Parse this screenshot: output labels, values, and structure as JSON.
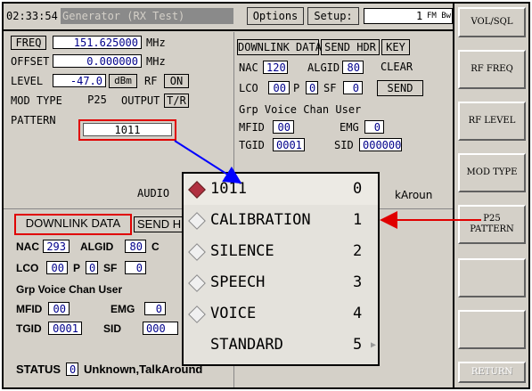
{
  "header": {
    "time": "02:33:54",
    "title": "Generator (RX Test)",
    "options_label": "Options",
    "setup_label": "Setup:",
    "setup_value": "1",
    "setup_unit": "FM Bw"
  },
  "generator": {
    "freq_label": "FREQ",
    "freq_value": "151.625000",
    "freq_unit": "MHz",
    "offset_label": "OFFSET",
    "offset_value": "0.000000",
    "offset_unit": "MHz",
    "level_label": "LEVEL",
    "level_value": "-47.0",
    "level_unit": "dBm",
    "rf_label": "RF",
    "rf_value": "ON",
    "modtype_label": "MOD TYPE",
    "modtype_value": "P25",
    "output_label": "OUTPUT",
    "output_value": "T/R",
    "pattern_label": "PATTERN",
    "pattern_value": "1011",
    "audio_label": "AUDIO"
  },
  "downlink_top": {
    "tab_label": "DOWNLINK DATA",
    "send_hdr_label": "SEND HDR",
    "key_label": "KEY",
    "nac_label": "NAC",
    "nac_value": "120",
    "algid_label": "ALGID",
    "algid_value": "80",
    "clear_label": "CLEAR",
    "lco_label": "LCO",
    "lco_value": "00",
    "p_label": "P",
    "p_value": "0",
    "sf_label": "SF",
    "sf_value": "0",
    "send_label": "SEND",
    "grp_label": "Grp Voice Chan User",
    "mfid_label": "MFID",
    "mfid_value": "00",
    "emg_label": "EMG",
    "emg_value": "0",
    "tgid_label": "TGID",
    "tgid_value": "0001",
    "sid_label": "SID",
    "sid_value": "000000",
    "status_partial": "kAroun"
  },
  "downlink_bottom": {
    "tab_label": "DOWNLINK DATA",
    "send_partial": "SEND HD",
    "nac_label": "NAC",
    "nac_value": "293",
    "algid_label": "ALGID",
    "algid_value": "80",
    "c_partial": "C",
    "lco_label": "LCO",
    "lco_value": "00",
    "p_label": "P",
    "p_value": "0",
    "sf_label": "SF",
    "sf_value": "0",
    "grp_label": "Grp Voice Chan User",
    "mfid_label": "MFID",
    "mfid_value": "00",
    "emg_label": "EMG",
    "emg_value": "0",
    "tgid_label": "TGID",
    "tgid_value": "0001",
    "sid_label": "SID",
    "sid_partial": "000"
  },
  "status": {
    "label": "STATUS",
    "value": "0",
    "text": "Unknown,TalkAround"
  },
  "dropdown": {
    "items": [
      {
        "label": "1011",
        "num": "0"
      },
      {
        "label": "CALIBRATION",
        "num": "1"
      },
      {
        "label": "SILENCE",
        "num": "2"
      },
      {
        "label": "SPEECH",
        "num": "3"
      },
      {
        "label": "VOICE",
        "num": "4"
      },
      {
        "label": "STANDARD",
        "num": "5"
      }
    ],
    "selected_index": 0
  },
  "sidebar": {
    "buttons": [
      "VOL/SQL",
      "RF FREQ",
      "RF LEVEL",
      "MOD TYPE",
      "P25 PATTERN",
      "",
      "",
      "RETURN"
    ]
  },
  "colors": {
    "annotation_red": "#e00000",
    "annotation_blue": "#0000ff",
    "value_blue": "#00008b",
    "panel": "#d4d0c8"
  }
}
